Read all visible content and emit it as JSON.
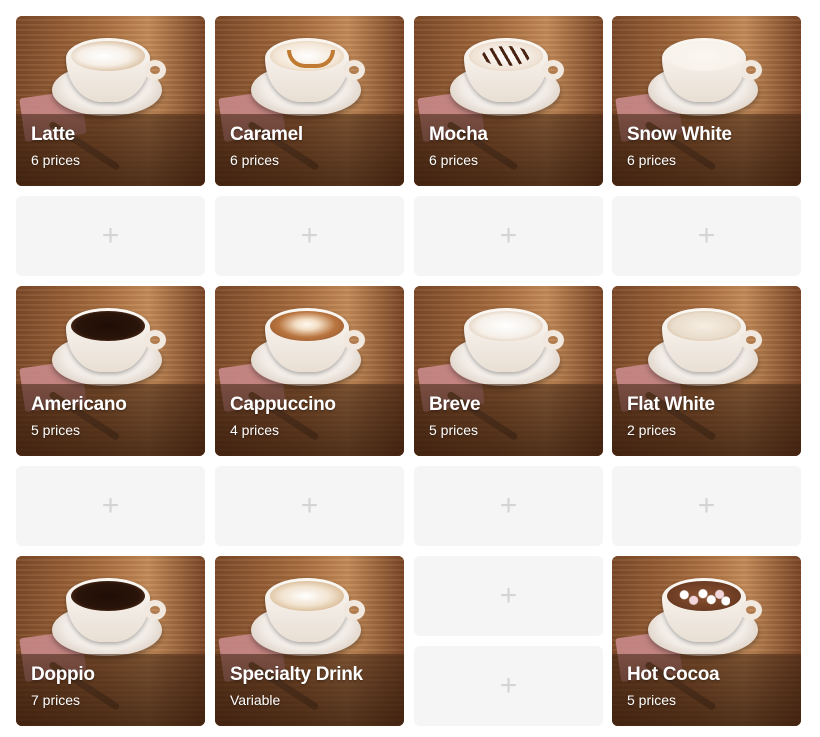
{
  "products": [
    {
      "name": "Latte",
      "sub": "6 prices",
      "liquid": "#f6efe6",
      "deco": "latte-art"
    },
    {
      "name": "Caramel",
      "sub": "6 prices",
      "liquid": "#f3e6d6",
      "deco": "caramel-drizzle"
    },
    {
      "name": "Mocha",
      "sub": "6 prices",
      "liquid": "#efe2d4",
      "deco": "chocolate-drizzle"
    },
    {
      "name": "Snow White",
      "sub": "6 prices",
      "liquid": "#f7f2ea",
      "deco": "none"
    },
    {
      "name": "Americano",
      "sub": "5 prices",
      "liquid": "#2a140a",
      "deco": "crema"
    },
    {
      "name": "Cappuccino",
      "sub": "4 prices",
      "liquid": "#b8743f",
      "deco": "rosetta"
    },
    {
      "name": "Breve",
      "sub": "5 prices",
      "liquid": "#f5efe8",
      "deco": "foam"
    },
    {
      "name": "Flat White",
      "sub": "2 prices",
      "liquid": "#e9dccb",
      "deco": "foam-bubbles"
    },
    {
      "name": "Doppio",
      "sub": "7 prices",
      "liquid": "#2a140a",
      "deco": "crema"
    },
    {
      "name": "Specialty Drink",
      "sub": "Variable",
      "liquid": "#f1e3cf",
      "deco": "latte-art"
    },
    {
      "name": "Hot Cocoa",
      "sub": "5 prices",
      "liquid": "#6b3b22",
      "deco": "marshmallows"
    }
  ],
  "empty_slot": {
    "icon": "plus-icon",
    "symbol": "+"
  }
}
